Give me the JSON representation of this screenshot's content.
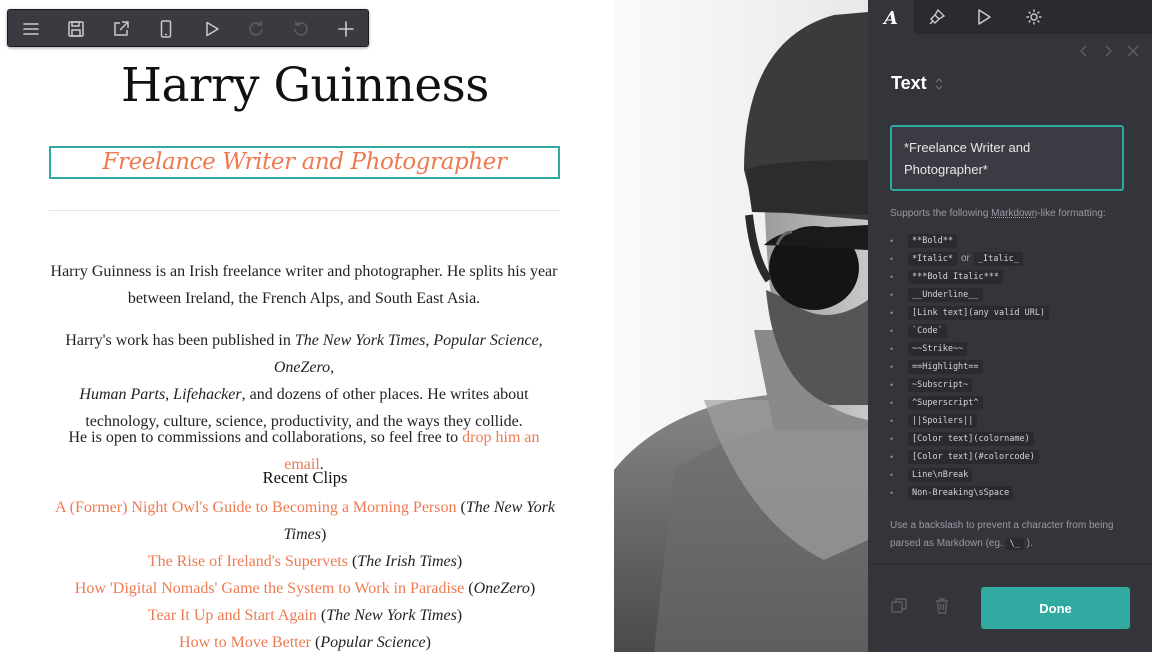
{
  "page": {
    "name": "Harry Guinness",
    "tagline": "Freelance Writer and Photographer",
    "bio1": {
      "a": "Harry Guinness is an Irish freelance writer and photographer. He splits his year between Ireland, the French Alps, and South East Asia."
    },
    "bio2": {
      "a": "Harry's work has been published in ",
      "nyt": "The New York Times",
      "c1": ", ",
      "ps": "Popular Science",
      "c2": ", ",
      "oz": "OneZero",
      "c3": ", ",
      "hp": "Human Parts",
      "c4": ", ",
      "lh": "Lifehacker",
      "b": ", and dozens of other places. He writes about technology, culture, science, productivity, and the ways they collide."
    },
    "bio3": {
      "a": "He is open to commissions and collaborations, so feel free to ",
      "link": "drop him an email",
      "b": "."
    },
    "clips_heading": "Recent Clips",
    "clips": [
      {
        "title": "A (Former) Night Owl's Guide to Becoming a Morning Person",
        "source": "The New York Times"
      },
      {
        "title": "The Rise of Ireland's Supervets",
        "source": "The Irish Times"
      },
      {
        "title": "How 'Digital Nomads' Game the System to Work in Paradise",
        "source": "OneZero"
      },
      {
        "title": "Tear It Up and Start Again",
        "source": "The New York Times"
      },
      {
        "title": "How to Move Better",
        "source": "Popular Science"
      }
    ]
  },
  "toolbar": {
    "icons": [
      "menu-icon",
      "save-icon",
      "external-link-icon",
      "mobile-preview-icon",
      "play-icon",
      "redo-icon",
      "undo-icon",
      "add-icon"
    ]
  },
  "panel": {
    "tabs": [
      "text-style-icon",
      "style-brush-icon",
      "play-icon",
      "gear-icon"
    ],
    "title": "Text",
    "field_value": "*Freelance Writer and Photographer*",
    "md_intro_a": "Supports the following ",
    "md_intro_link": "Markdown",
    "md_intro_b": "-like formatting:",
    "md_items": [
      "**Bold**",
      "*Italic*",
      "_Italic_",
      "***Bold Italic***",
      "__Underline__",
      "[Link text](any valid URL)",
      "`Code`",
      "~~Strike~~",
      "==Highlight==",
      "~Subscript~",
      "^Superscript^",
      "||Spoilers||",
      "[Color text](colorname)",
      "[Color text](#colorcode)",
      "Line\\nBreak",
      "Non-Breaking\\sSpace"
    ],
    "or_label": "or",
    "md_note_a": "Use a backslash to prevent a character from being parsed as Markdown (eg.",
    "md_note_code": "\\_",
    "md_note_b": ").",
    "done_label": "Done"
  },
  "colors": {
    "accent_teal": "#2fa8a2",
    "link_orange": "#ee7a51",
    "panel_bg": "#34353b",
    "toolbar_bg": "#3a3b41"
  }
}
